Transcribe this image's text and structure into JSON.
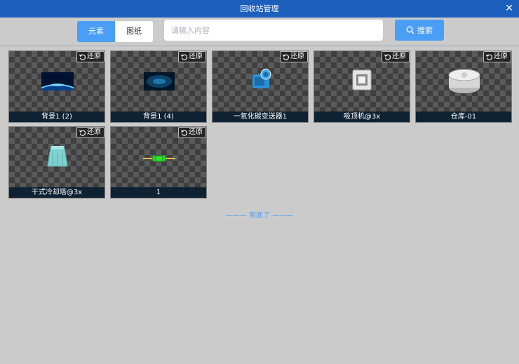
{
  "window": {
    "title": "回收站管理",
    "close_symbol": "✕"
  },
  "tabs": [
    {
      "label": "元素",
      "active": true
    },
    {
      "label": "图纸",
      "active": false
    }
  ],
  "search": {
    "placeholder": "请输入内容",
    "value": "",
    "button_label": "搜索"
  },
  "items": [
    {
      "label": "背景1 (2)",
      "restore_label": "还原",
      "thumb": "earth-horizon"
    },
    {
      "label": "背景1 (4)",
      "restore_label": "还原",
      "thumb": "blue-glow"
    },
    {
      "label": "一氧化碳变送器1",
      "restore_label": "还原",
      "thumb": "co-transmitter"
    },
    {
      "label": "吸顶机@3x",
      "restore_label": "还原",
      "thumb": "ceiling-unit"
    },
    {
      "label": "仓库-01",
      "restore_label": "还原",
      "thumb": "warehouse-tank"
    },
    {
      "label": "干式冷却塔@3x",
      "restore_label": "还原",
      "thumb": "cooling-tower"
    },
    {
      "label": "1",
      "restore_label": "还原",
      "thumb": "resistor"
    }
  ],
  "footer": {
    "end_text": "——— 到底了 ———"
  },
  "colors": {
    "accent": "#4a9ef5",
    "titlebar": "#1d5fbd",
    "background": "#cbcbcb",
    "label_bg": "#0f2233"
  }
}
